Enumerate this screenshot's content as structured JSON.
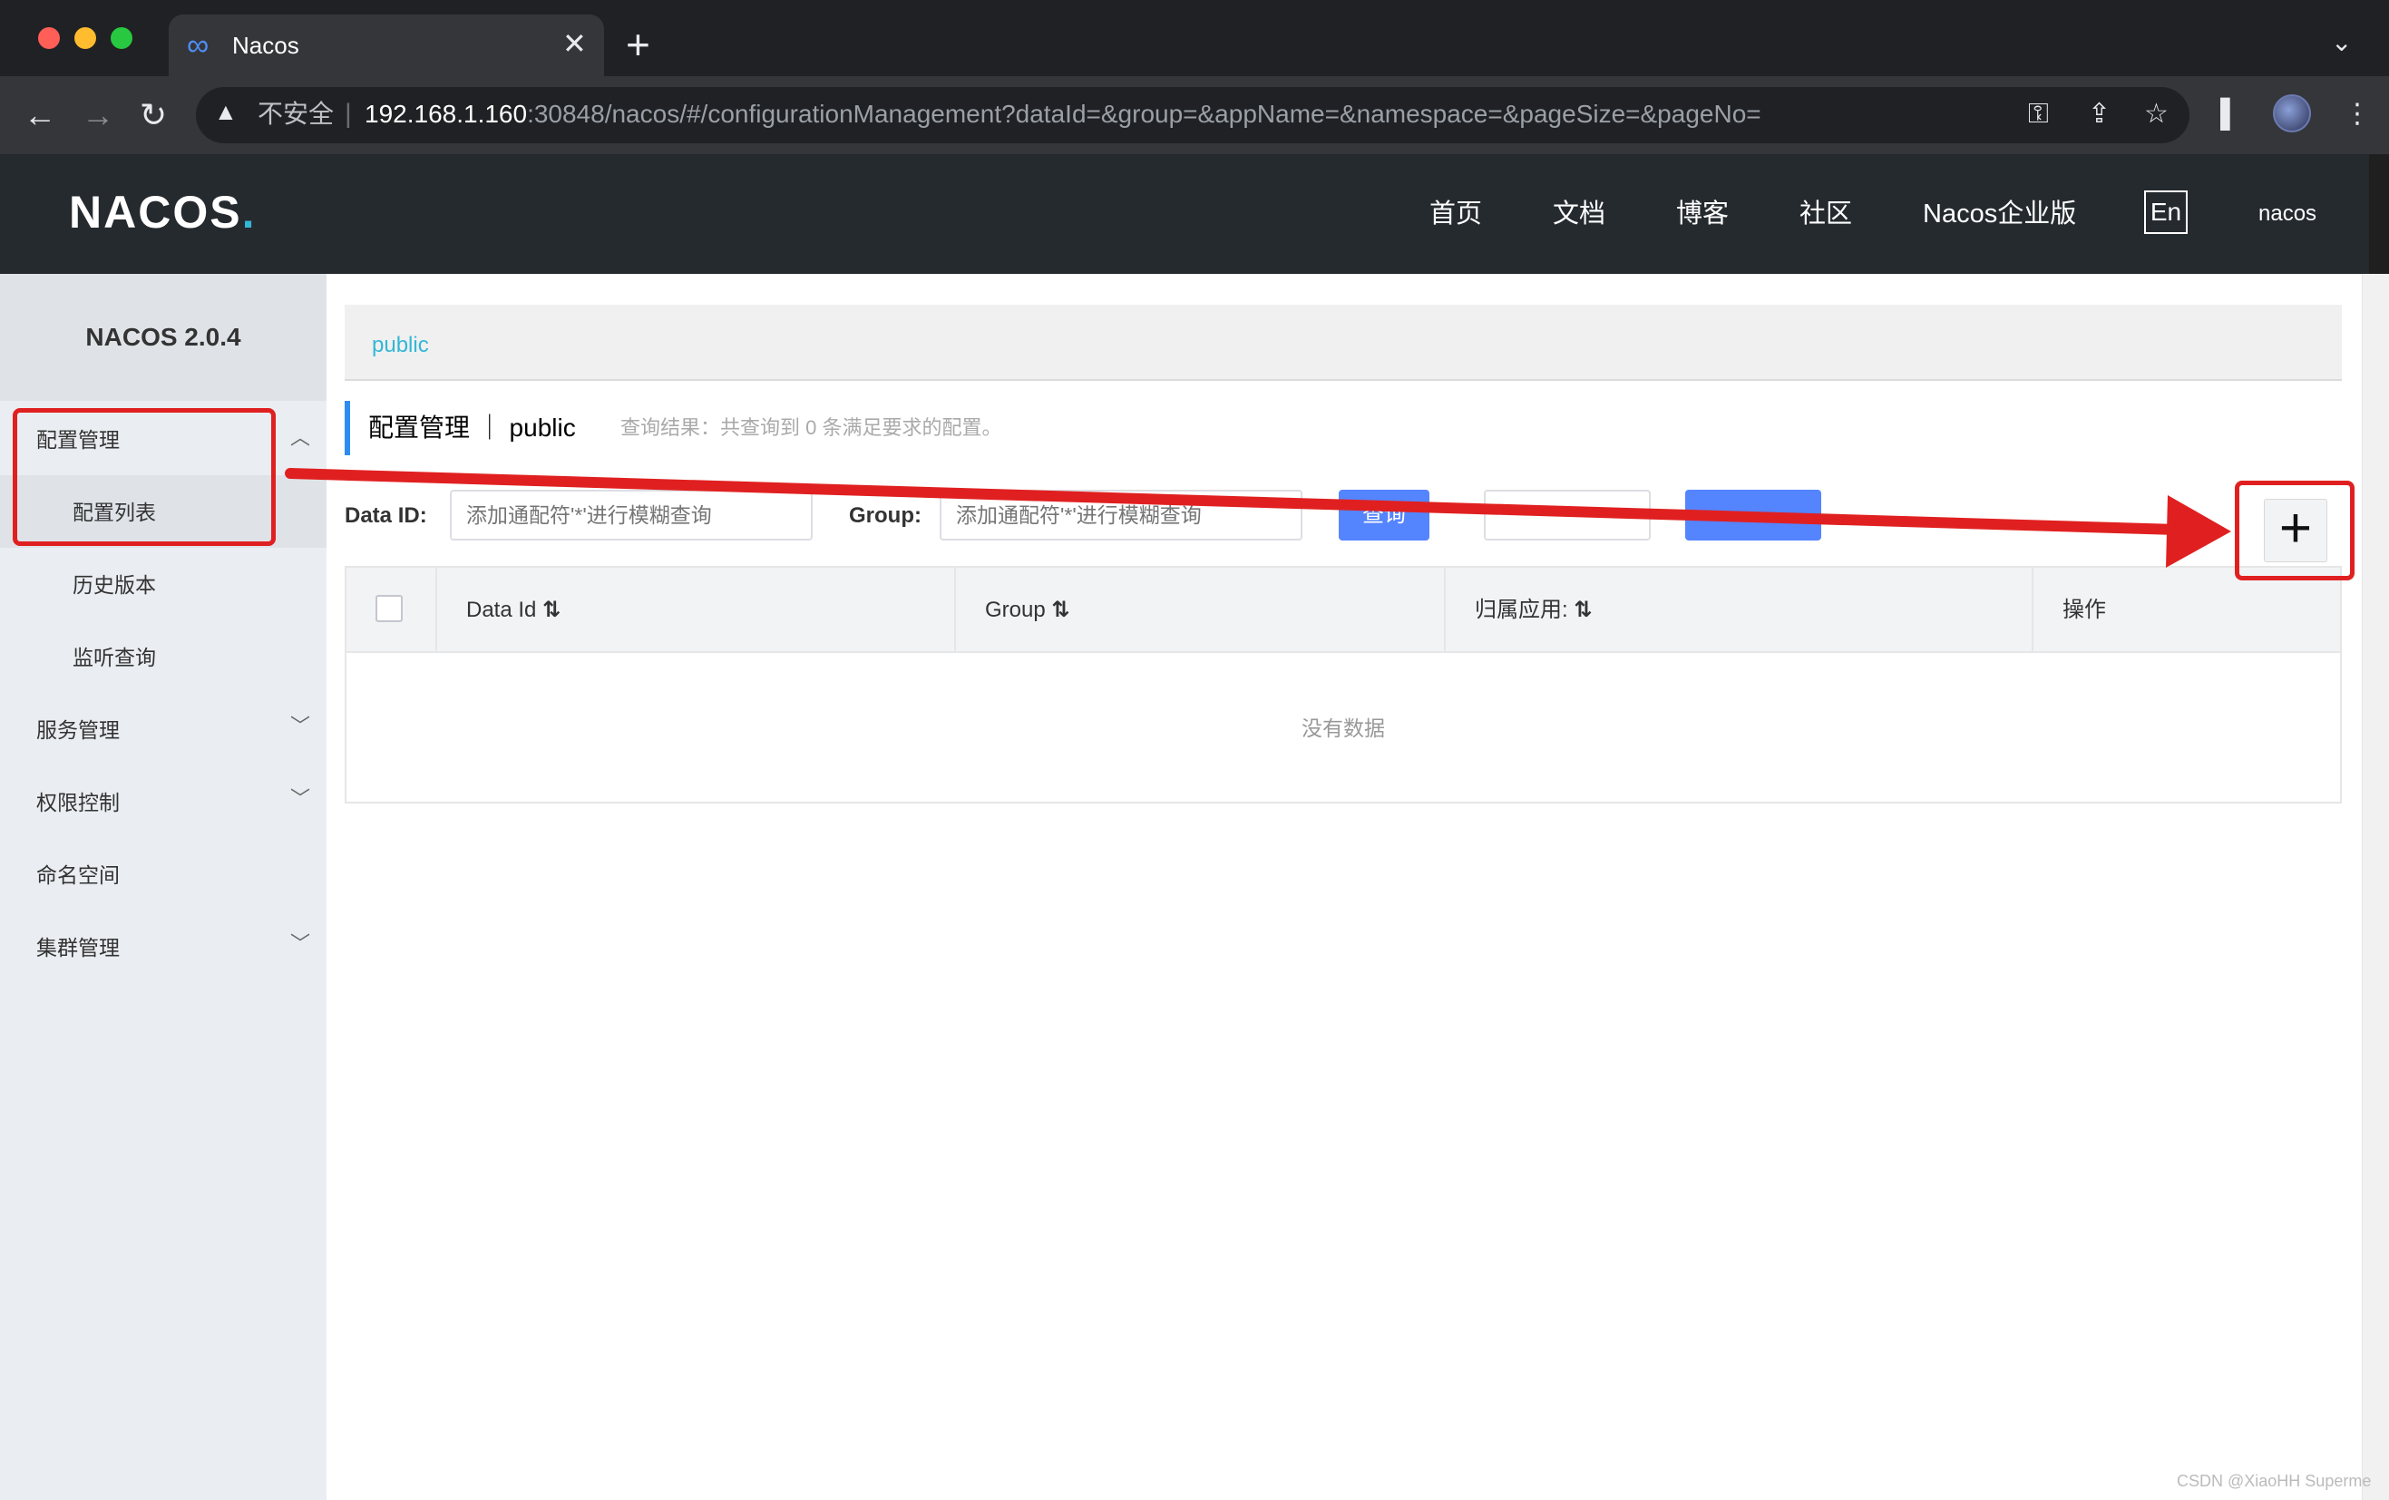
{
  "browser": {
    "tab_title": "Nacos",
    "security_label": "不安全",
    "url_host": "192.168.1.160",
    "url_rest": ":30848/nacos/#/configurationManagement?dataId=&group=&appName=&namespace=&pageSize=&pageNo="
  },
  "header": {
    "logo": "NACOS",
    "nav": [
      "首页",
      "文档",
      "博客",
      "社区",
      "Nacos企业版"
    ],
    "lang": "En",
    "user": "nacos"
  },
  "sidebar": {
    "title": "NACOS 2.0.4",
    "items": [
      {
        "label": "配置管理"
      },
      {
        "label": "配置列表"
      },
      {
        "label": "历史版本"
      },
      {
        "label": "监听查询"
      },
      {
        "label": "服务管理"
      },
      {
        "label": "权限控制"
      },
      {
        "label": "命名空间"
      },
      {
        "label": "集群管理"
      }
    ]
  },
  "main": {
    "breadcrumb": "public",
    "page_title": "配置管理 ｜ public",
    "query_result": "查询结果：共查询到 0 条满足要求的配置。",
    "filters": {
      "data_id_label": "Data ID:",
      "data_id_placeholder": "添加通配符'*'进行模糊查询",
      "group_label": "Group:",
      "group_placeholder": "添加通配符'*'进行模糊查询",
      "query_button": "查询"
    },
    "add_button": "+",
    "table": {
      "columns": [
        "Data Id",
        "Group",
        "归属应用:",
        "操作"
      ],
      "empty_text": "没有数据"
    }
  },
  "watermark": "CSDN @XiaoHH Superme",
  "annotation_color": "#e02020",
  "accent_color": "#5584ff"
}
